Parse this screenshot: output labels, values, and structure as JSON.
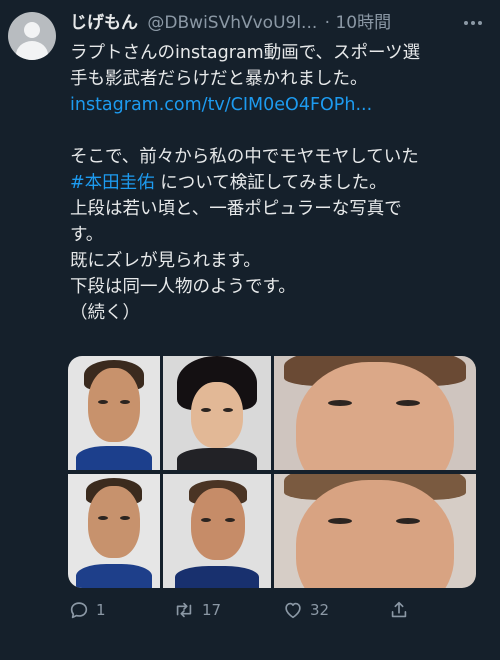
{
  "tweet": {
    "display_name": "じげもん",
    "handle": "@DBwiSVhVvoU9l...",
    "separator": "·",
    "time": "10時間",
    "lines": [
      "ラプトさんのinstagram動画で、スポーツ選",
      "手も影武者だらけだと暴かれました。"
    ],
    "link": "instagram.com/tv/CIM0eO4FOPh...",
    "para2_line1": "そこで、前々から私の中でモヤモヤしていた",
    "hashtag": "#本田圭佑",
    "after_hashtag": " について検証してみました。",
    "rest": "上段は若い頃と、一番ポピュラーな写真で\nす。\n既にズレが見られます。\n下段は同一人物のようです。\n（続く）"
  },
  "actions": {
    "reply_count": "1",
    "retweet_count": "17",
    "like_count": "32"
  },
  "icons": [
    "avatar-placeholder-icon",
    "more-icon",
    "reply-icon",
    "retweet-icon",
    "like-icon",
    "share-icon"
  ],
  "colors": {
    "background": "#15202b",
    "text": "#e7e9ea",
    "muted": "#8b98a5",
    "link": "#1d9bf0"
  }
}
